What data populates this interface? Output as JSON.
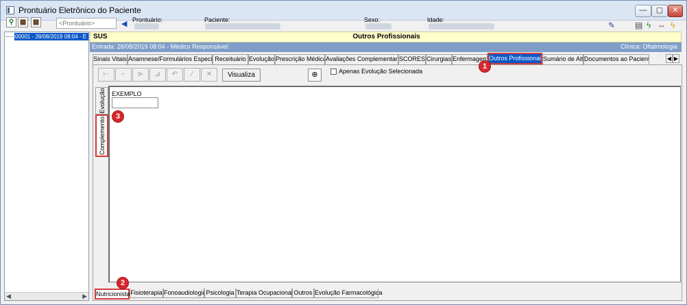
{
  "window": {
    "title": "Prontuário Eletrônico do Paciente",
    "minimize": "—",
    "maximize": "▢",
    "close": "✕"
  },
  "header": {
    "prontuario_placeholder": "<Prontuário>",
    "labels": {
      "prontuario": "Prontuário:",
      "paciente": "Paciente:",
      "sexo": "Sexo:",
      "idade": "Idade:"
    }
  },
  "tree": {
    "item": "00001 - 28/08/2019 08:04 - E"
  },
  "sus_bar": {
    "sus": "SUS",
    "module": "Outros Profissionais"
  },
  "entry_bar": {
    "left": "Entrada: 28/08/2019 08:04 - Médico Responsável:",
    "right": "Clínica: Oftalmologia"
  },
  "top_tabs": [
    "Sinais Vitais",
    "Anamnese/Formulários Especiais",
    "Receituário",
    "Evolução",
    "Prescrição Médica",
    "Avaliações Complementares",
    "SCORES",
    "Cirurgias",
    "Enfermagem",
    "Outros Profissionais",
    "Sumário de Alta",
    "Documentos ao Paciente"
  ],
  "toolbar": {
    "visualiza": "Visualiza",
    "apenas_label": "Apenas Evolução Selecionada"
  },
  "side_tabs": {
    "evolucao": "Evolução",
    "complemento": "Complemento"
  },
  "form": {
    "label": "EXEMPLO"
  },
  "bottom_tabs": [
    "Nutricionista",
    "Fisioterapia",
    "Fonoaudiologia",
    "Psicologia",
    "Terapia Ocupacional",
    "Outros",
    "Evolução Farmacológica"
  ],
  "badges": [
    "1",
    "2",
    "3"
  ],
  "colors": {
    "active_tab": "#0a58c9",
    "highlight": "#d23b3b",
    "sus_bar": "#ffffcc",
    "entry_bar": "#7f9dc7"
  }
}
